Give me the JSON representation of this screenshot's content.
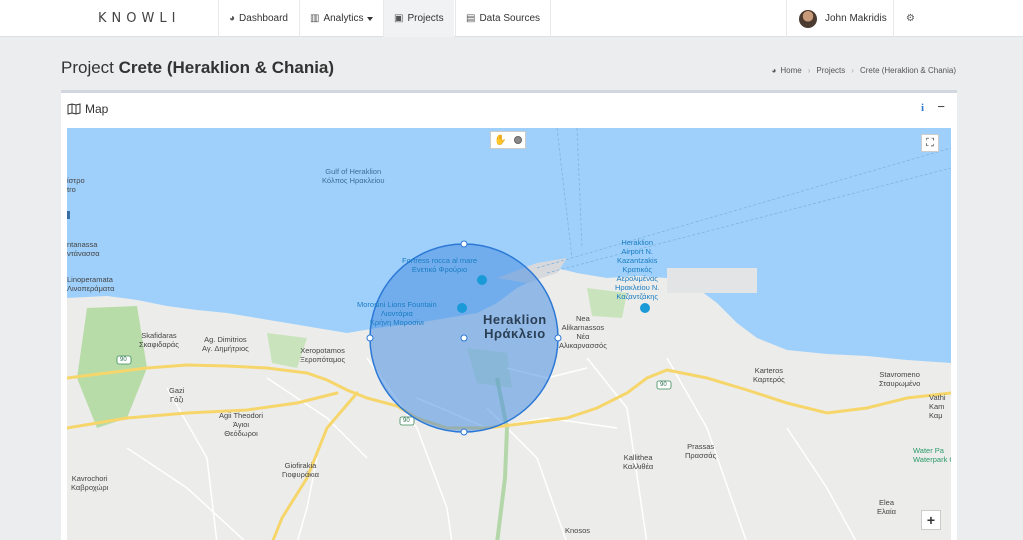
{
  "brand": {
    "logo_text": "KNOWLI"
  },
  "nav": {
    "dashboard": "Dashboard",
    "analytics": "Analytics",
    "projects": "Projects",
    "data_sources": "Data Sources",
    "user_name": "John Makridis"
  },
  "page": {
    "title_prefix": "Project",
    "title_name": "Crete (Heraklion & Chania)"
  },
  "breadcrumb": {
    "home": "Home",
    "projects": "Projects",
    "current": "Crete (Heraklion & Chania)"
  },
  "panel": {
    "title": "Map",
    "info_label": "i",
    "minimize_label": "−"
  },
  "map": {
    "zoom_in": "+",
    "labels": {
      "gulf": "Gulf of Heraklion",
      "gulf_gr": "Κόλπος Ηρακλείου",
      "fortress": "Fortress rocca al mare",
      "fortress_gr": "Ενετικό Φρούριο",
      "morosini": "Morosini Lions Fountain",
      "morosini_gr1": "Λιοντάρια",
      "morosini_gr2": "Κρήνη Μοροσίνι",
      "heraklion": "Heraklion",
      "heraklion_gr": "Ηράκλειο",
      "airport": "Heraklion",
      "airport2": "Airport N.",
      "airport3": "Kazantzakis",
      "airport_gr1": "Κρατικός",
      "airport_gr2": "Αερολιμένας",
      "airport_gr3": "Ηρακλείου Ν.",
      "airport_gr4": "Καζαντζάκης",
      "nea": "Nea",
      "nea2": "Alikarnassos",
      "nea_gr1": "Νέα",
      "nea_gr2": "Αλικαρνασσός",
      "skafidaras": "Skafidaras",
      "skafidaras_gr": "Σκαφιδαράς",
      "agdim": "Ag. Dimitrios",
      "agdim_gr": "Αγ. Δημήτριος",
      "xeropot": "Xeropotamos",
      "xeropot_gr": "Ξεροπόταμος",
      "gazi": "Gazi",
      "gazi_gr": "Γάζι",
      "agtheo": "Agii Theodori",
      "agtheo_gr": "Άγιοι",
      "agtheo_gr2": "Θεόδωροι",
      "giofir": "Giofirakia",
      "giofir_gr": "Γιοφυράκια",
      "kavro": "Kavrochori",
      "kavro_gr": "Καβροχώρι",
      "karteros": "Karteros",
      "karteros_gr": "Καρτερός",
      "stavro": "Stavromeno",
      "stavro_gr": "Σταυρωμένο",
      "prassas": "Prassas",
      "prassas_gr": "Πρασσάς",
      "kallithea": "Kallithea",
      "kallithea_gr": "Καλλιθέα",
      "elea": "Elea",
      "elea_gr": "Ελαία",
      "knosos": "Knosos",
      "vathi": "Vathi",
      "kam": "Kam",
      "kam_gr": "Καμ",
      "waterpark": "Water Pa",
      "waterpark2": "Waterpark Cr",
      "lino": "Linoperamata",
      "lino_gr": "Λινοπεράματα",
      "antanassa": "ntanassa",
      "antanassa_gr": "ντάνασσα",
      "istro": "ίστρο",
      "istro2": "tro",
      "road_90a": "90",
      "road_90b": "90",
      "road_90c": "90"
    }
  },
  "colors": {
    "sea": "#9fd0fb",
    "land": "#ececea",
    "circle_fill": "#4a90e2",
    "circle_stroke": "#2b78d6",
    "road_main": "#f6d66b",
    "road_minor": "#ffffff",
    "green": "#b8dca8"
  }
}
